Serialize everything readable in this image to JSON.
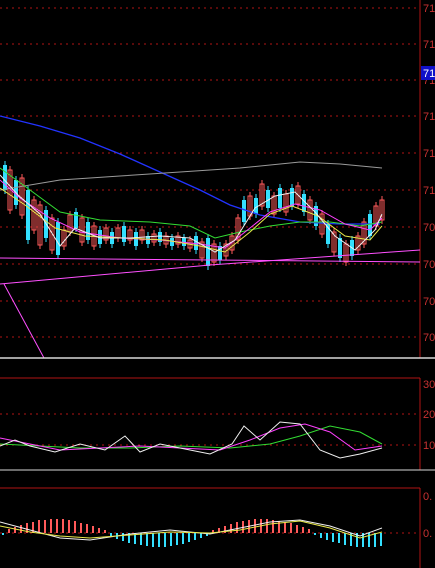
{
  "colors": {
    "background": "#000000",
    "grid_red": "#b01515",
    "panel_border": "#b01515",
    "separator": "#d8d8d8",
    "up_candle": "#ff5a5a",
    "down_candle": "#33e0ff",
    "ma_white": "#f0f0f0",
    "ma_yellow": "#e8e84a",
    "ma_magenta": "#ff40ff",
    "ma_green": "#33dd33",
    "ma_gray": "#9a9a9a",
    "ma_blue": "#2233ff",
    "trendline": "#ff50ff",
    "price_tag_bg": "#1010c8"
  },
  "main_chart": {
    "y_tick_labels": [
      "71",
      "71",
      "71",
      "71",
      "71",
      "71",
      "70",
      "70",
      "70",
      "70",
      "70",
      "70",
      "70"
    ],
    "highlight_tag": "71"
  },
  "chart_data": [
    {
      "type": "line",
      "panel": "price",
      "series": [
        {
          "values": [
            71.3,
            71.3,
            71.2,
            71.1,
            71.0,
            70.9,
            70.9,
            70.8,
            70.7,
            70.7,
            70.6,
            70.6,
            70.6
          ]
        },
        {
          "values": [
            71.0,
            71.0,
            71.0,
            71.0,
            71.0,
            71.1,
            71.1,
            71.1,
            71.1,
            71.1,
            71.1,
            71.1,
            71.0
          ]
        },
        {
          "values": [
            70.9,
            70.8,
            70.7,
            70.7,
            70.7,
            70.6,
            70.6,
            70.6,
            70.6,
            70.7,
            70.7,
            70.7,
            70.7
          ]
        }
      ]
    },
    {
      "type": "line",
      "panel": "indicator-1",
      "y_tick_labels": [
        "30",
        "20",
        "10"
      ]
    },
    {
      "type": "bar",
      "panel": "indicator-2",
      "y_tick_labels": [
        "0.",
        "0."
      ]
    }
  ]
}
